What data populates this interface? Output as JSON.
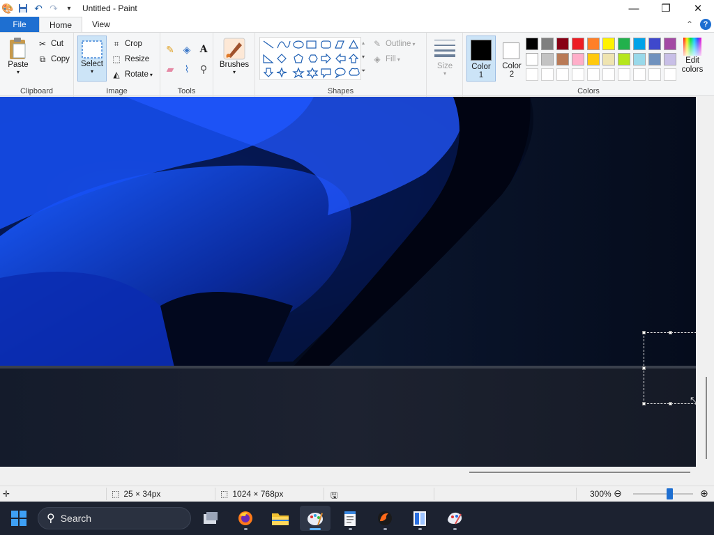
{
  "window": {
    "title": "Untitled - Paint",
    "qa_icons": [
      "paint-app-icon",
      "save-icon",
      "undo-icon",
      "redo-icon",
      "customize-qa-icon"
    ],
    "controls": {
      "minimize": "—",
      "maximize": "❐",
      "close": "✕"
    }
  },
  "tabs": {
    "file": "File",
    "home": "Home",
    "view": "View",
    "collapse": "⌃",
    "help": "?"
  },
  "clipboard": {
    "label": "Clipboard",
    "paste": "Paste",
    "cut": "Cut",
    "copy": "Copy"
  },
  "image": {
    "label": "Image",
    "select": "Select",
    "crop": "Crop",
    "resize": "Resize",
    "rotate": "Rotate"
  },
  "tools": {
    "label": "Tools",
    "text_glyph": "A"
  },
  "brushes": {
    "label": "Brushes"
  },
  "shapes": {
    "label": "Shapes",
    "outline": "Outline",
    "fill": "Fill"
  },
  "size": {
    "label": "Size"
  },
  "colors": {
    "label": "Colors",
    "color1_label": "Color",
    "color1_num": "1",
    "color2_label": "Color",
    "color2_num": "2",
    "edit_label_1": "Edit",
    "edit_label_2": "colors",
    "color1": "#000000",
    "color2": "#ffffff",
    "row1": [
      "#000000",
      "#7f7f7f",
      "#880015",
      "#ed1c24",
      "#ff7f27",
      "#fff200",
      "#22b14c",
      "#00a2e8",
      "#3f48cc",
      "#a349a4"
    ],
    "row2": [
      "#ffffff",
      "#c3c3c3",
      "#b97a57",
      "#ffaec9",
      "#ffc90e",
      "#efe4b0",
      "#b5e61d",
      "#99d9ea",
      "#7092be",
      "#c8bfe7"
    ],
    "row3": [
      "#ffffff",
      "#ffffff",
      "#ffffff",
      "#ffffff",
      "#ffffff",
      "#ffffff",
      "#ffffff",
      "#ffffff",
      "#ffffff",
      "#ffffff"
    ]
  },
  "status": {
    "selection_size": "25 × 34px",
    "canvas_size": "1024 × 768px",
    "zoom": "300%",
    "zoom_level": 0.6
  },
  "taskbar": {
    "search_placeholder": "Search",
    "apps": [
      "task-view-icon",
      "firefox-icon",
      "file-explorer-icon",
      "paint-icon",
      "notepad-icon",
      "app-icon",
      "books-icon",
      "paint-3d-icon"
    ]
  }
}
